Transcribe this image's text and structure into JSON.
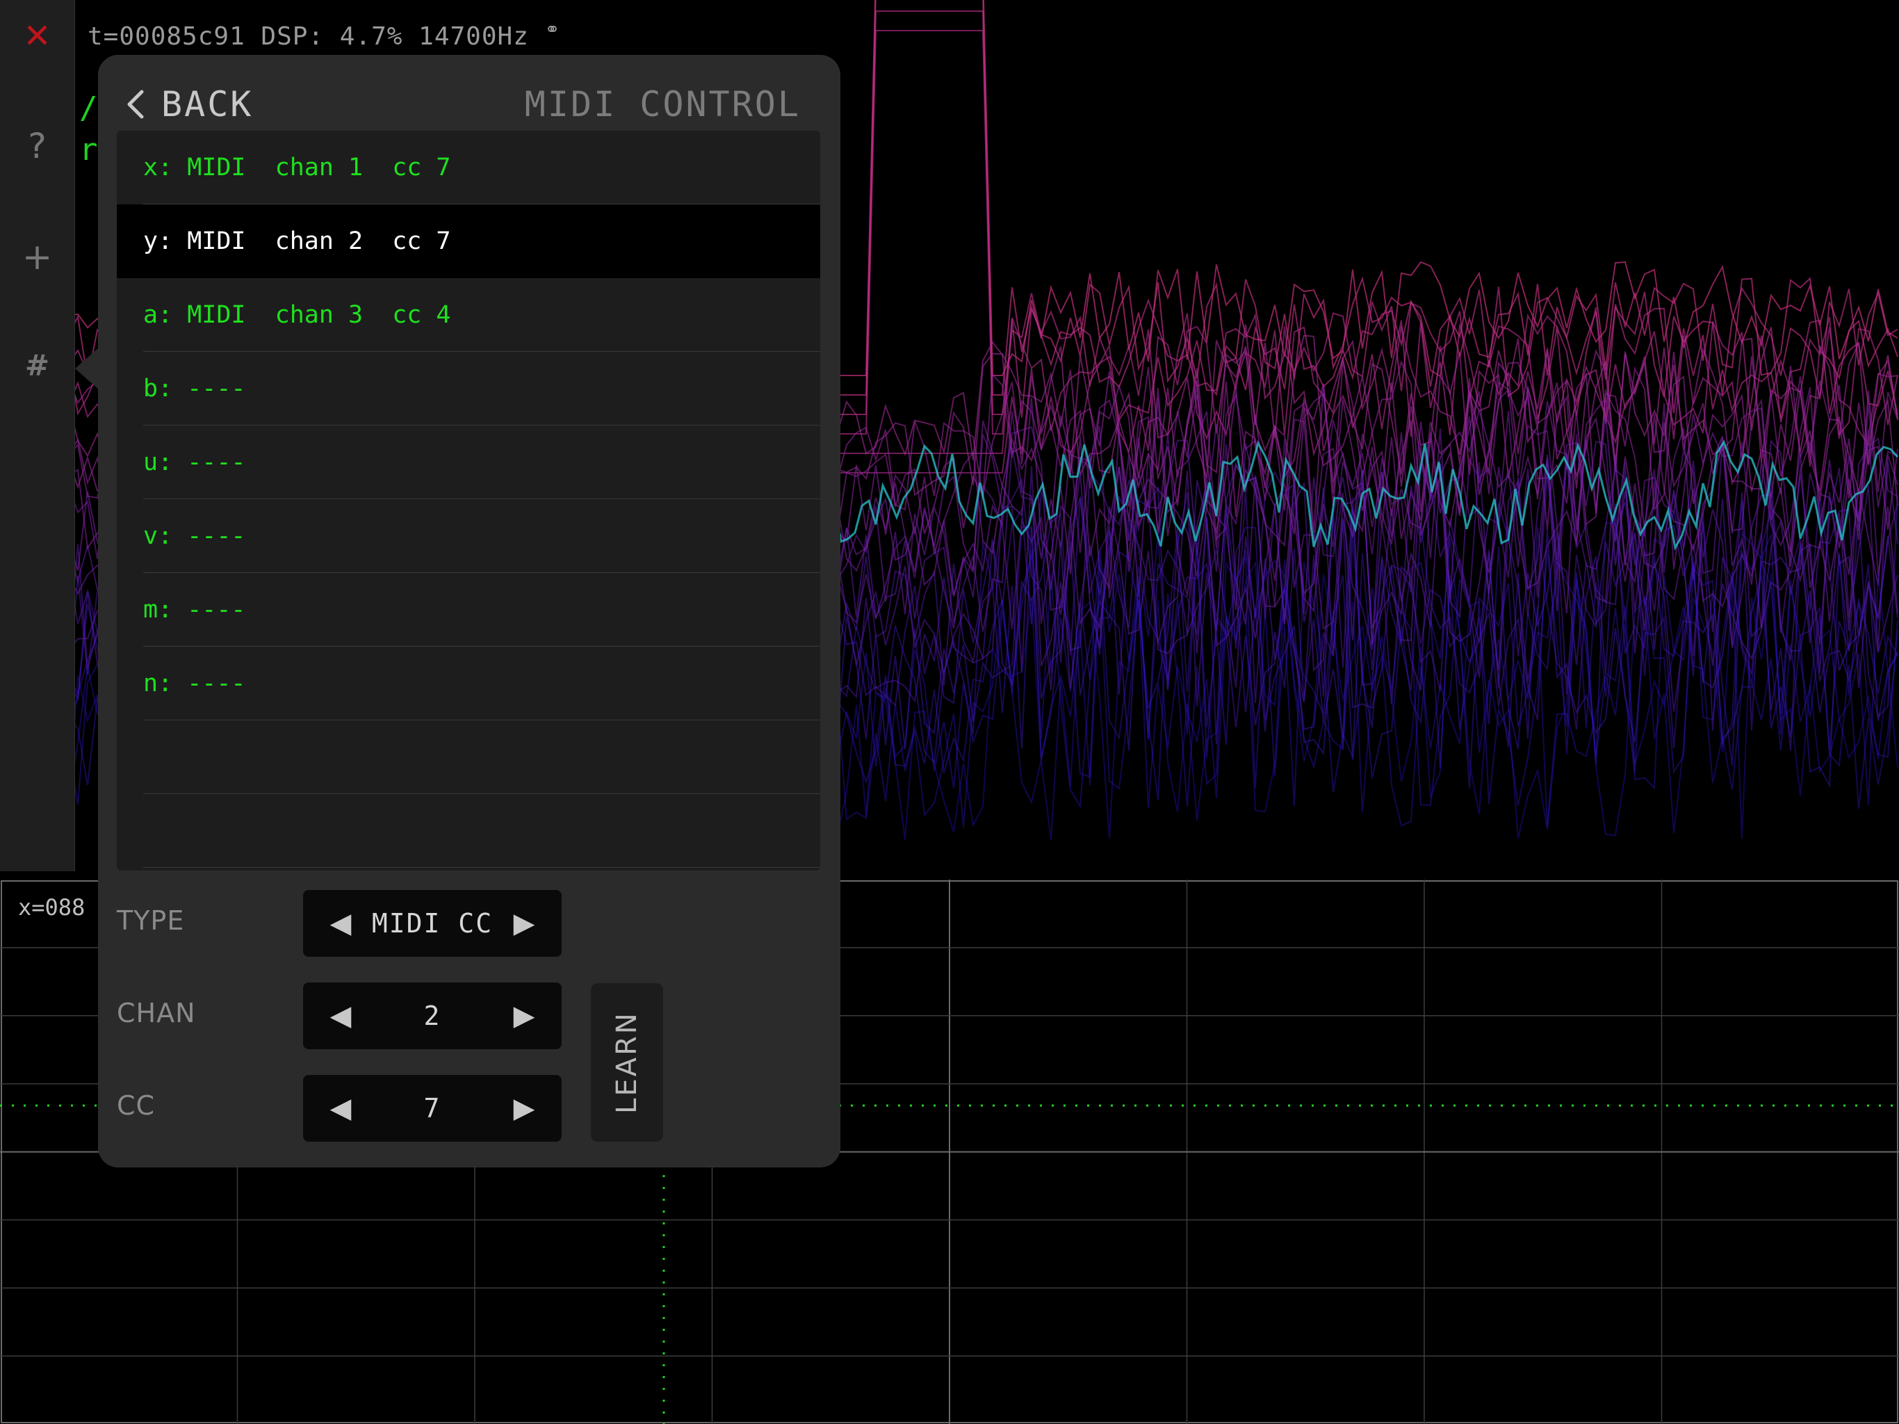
{
  "status": {
    "text": "t=00085c91 DSP: 4.7% 14700Hz",
    "link_icon": "link-icon"
  },
  "code_hint": {
    "line1": "/",
    "line2": "r"
  },
  "sidebar": {
    "items": [
      {
        "name": "close",
        "glyph": "✕",
        "color": "#c0141c"
      },
      {
        "name": "help",
        "glyph": "?"
      },
      {
        "name": "add",
        "glyph": "+"
      },
      {
        "name": "grid",
        "glyph": "#"
      }
    ]
  },
  "scope": {
    "x_readout": "x=088"
  },
  "panel": {
    "back_label": "BACK",
    "title": "MIDI CONTROL",
    "mappings": [
      {
        "label": "x: MIDI  chan 1  cc 7",
        "selected": false
      },
      {
        "label": "y: MIDI  chan 2  cc 7",
        "selected": true
      },
      {
        "label": "a: MIDI  chan 3  cc 4",
        "selected": false
      },
      {
        "label": "b: ----",
        "selected": false
      },
      {
        "label": "u: ----",
        "selected": false
      },
      {
        "label": "v: ----",
        "selected": false
      },
      {
        "label": "m: ----",
        "selected": false
      },
      {
        "label": "n: ----",
        "selected": false
      },
      {
        "label": "",
        "selected": false
      },
      {
        "label": "",
        "selected": false
      }
    ],
    "type": {
      "label": "TYPE",
      "value": "MIDI CC"
    },
    "chan": {
      "label": "CHAN",
      "value": "2"
    },
    "cc": {
      "label": "CC",
      "value": "7"
    },
    "learn_label": "LEARN"
  },
  "colors": {
    "accent_green": "#1fe01f",
    "close_red": "#c0141c",
    "panel_bg": "#2b2b2b"
  }
}
